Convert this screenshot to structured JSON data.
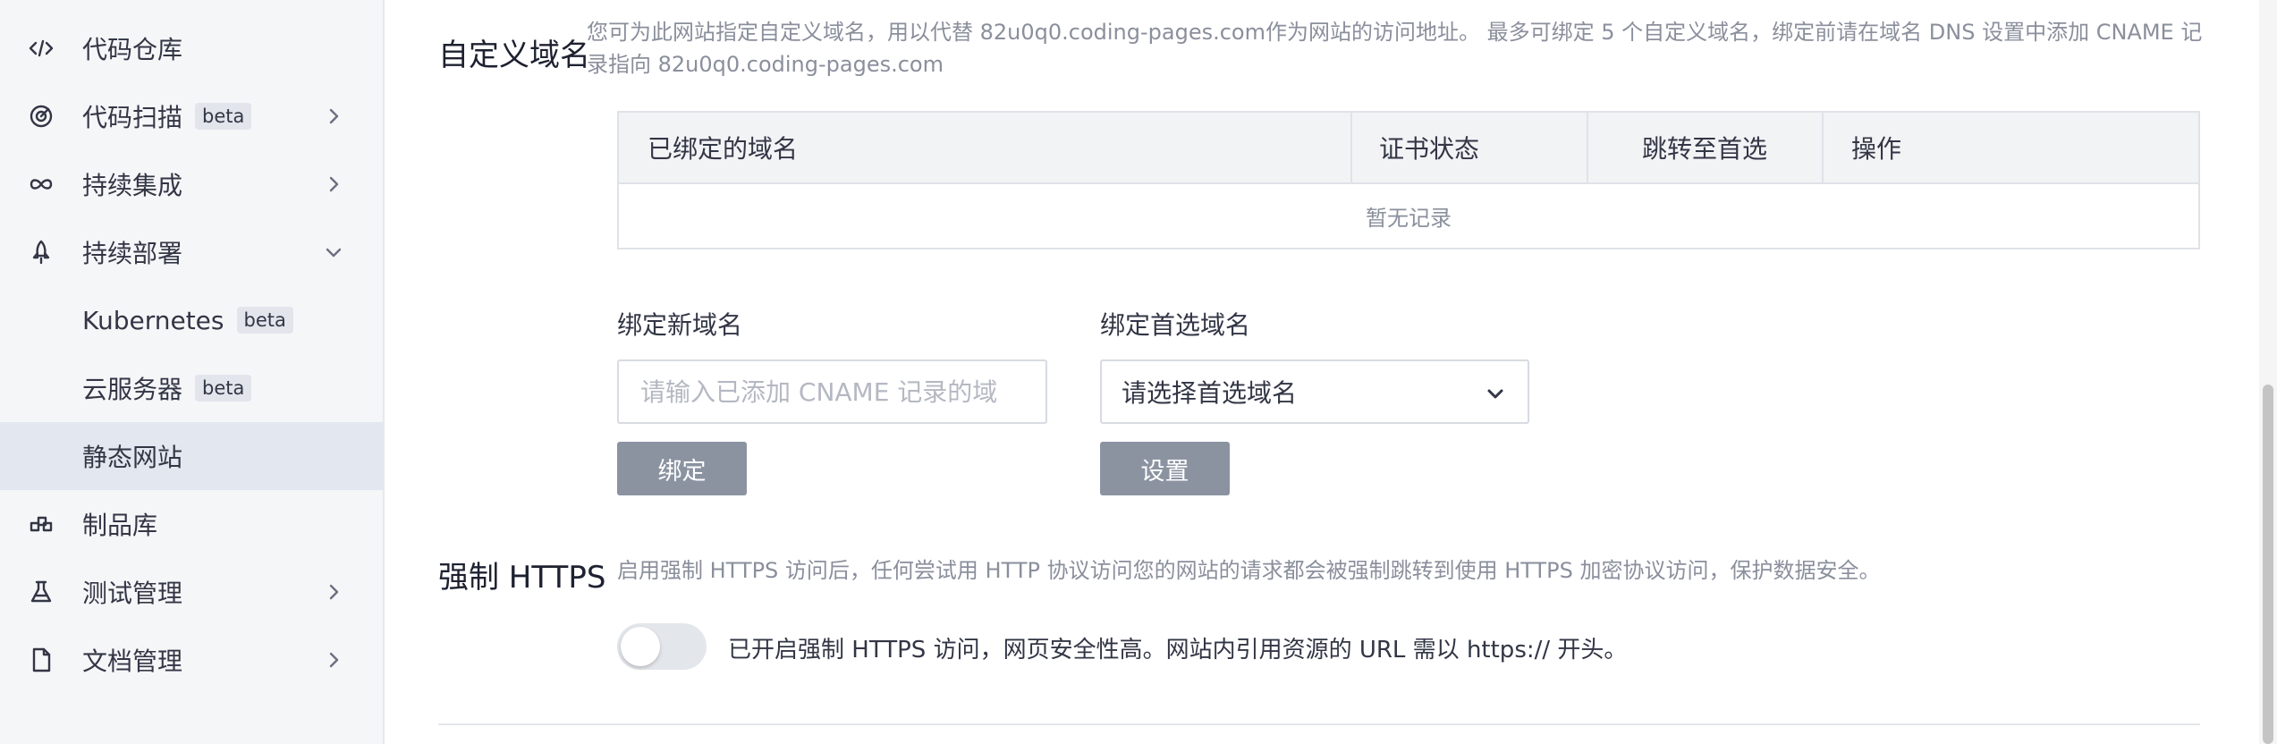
{
  "sidebar": {
    "items": [
      {
        "label": "代码仓库",
        "badge": "",
        "icon": "code-icon",
        "chevron": ""
      },
      {
        "label": "代码扫描",
        "badge": "beta",
        "icon": "scan-icon",
        "chevron": "right"
      },
      {
        "label": "持续集成",
        "badge": "",
        "icon": "infinity-icon",
        "chevron": "right"
      },
      {
        "label": "持续部署",
        "badge": "",
        "icon": "rocket-icon",
        "chevron": "down"
      },
      {
        "label": "Kubernetes",
        "badge": "beta",
        "icon": "",
        "chevron": ""
      },
      {
        "label": "云服务器",
        "badge": "beta",
        "icon": "",
        "chevron": ""
      },
      {
        "label": "静态网站",
        "badge": "",
        "icon": "",
        "chevron": "",
        "active": true
      },
      {
        "label": "制品库",
        "badge": "",
        "icon": "artifact-icon",
        "chevron": ""
      },
      {
        "label": "测试管理",
        "badge": "",
        "icon": "flask-icon",
        "chevron": "right"
      },
      {
        "label": "文档管理",
        "badge": "",
        "icon": "document-icon",
        "chevron": "right"
      }
    ]
  },
  "custom_domain": {
    "title": "自定义域名",
    "description_line1": "您可为此网站指定自定义域名，用以代替 82u0q0.coding-pages.com作为网站的访问地址。 最多可绑定 5 个自定义域名，绑定前请在域名 DNS 设置中添加 CNAME 记",
    "description_line2": "录指向 82u0q0.coding-pages.com",
    "table": {
      "headers": [
        "已绑定的域名",
        "证书状态",
        "跳转至首选",
        "操作"
      ],
      "empty_text": "暂无记录"
    },
    "bind_new": {
      "label": "绑定新域名",
      "placeholder": "请输入已添加 CNAME 记录的域",
      "button": "绑定"
    },
    "preferred": {
      "label": "绑定首选域名",
      "selected": "请选择首选域名",
      "button": "设置"
    }
  },
  "https": {
    "title": "强制 HTTPS",
    "description": "启用强制 HTTPS 访问后，任何尝试用 HTTP 协议访问您的网站的请求都会被强制跳转到使用 HTTPS 加密协议访问，保护数据安全。",
    "toggle_on": false,
    "toggle_text": "已开启强制 HTTPS 访问，网页安全性高。网站内引用资源的 URL 需以 https:// 开头。"
  }
}
